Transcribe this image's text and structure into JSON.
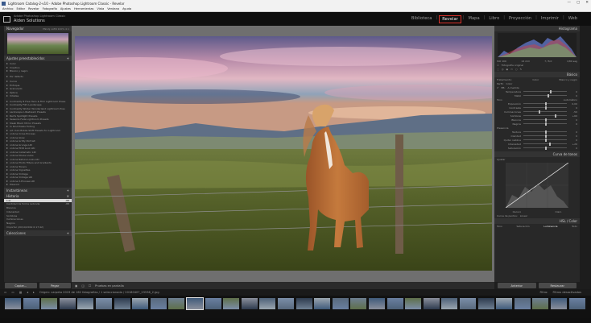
{
  "window": {
    "title": "Lightroom Catalog-2-v10 - Adobe Photoshop Lightroom Classic - Revelar",
    "controls": [
      "—",
      "▢",
      "✕"
    ]
  },
  "menu": [
    "Archivo",
    "Editar",
    "Revelar",
    "Fotografía",
    "Ajustes",
    "Herramientas",
    "Vista",
    "Ventana",
    "Ayuda"
  ],
  "identity": {
    "line1": "Adobe Photoshop Lightroom Classic",
    "line2": "Aiden Solutions"
  },
  "modules": [
    {
      "label": "Biblioteca",
      "active": false
    },
    {
      "label": "Revelar",
      "active": true
    },
    {
      "label": "Mapa",
      "active": false
    },
    {
      "label": "Libro",
      "active": false
    },
    {
      "label": "Proyección",
      "active": false
    },
    {
      "label": "Imprimir",
      "active": false
    },
    {
      "label": "Web",
      "active": false
    }
  ],
  "left_panel": {
    "navigator": {
      "title": "Navegador",
      "zoom_options": "ENCAJ  LLEN  100%  4:1"
    },
    "presets": {
      "title": "Ajustes preestablecidos",
      "items": [
        "Color",
        "Creativo",
        "Blanco y negro",
        "",
        "Por defecto",
        "",
        "Curva",
        "Enfoque",
        "Granulado",
        "Óptica",
        "Viñetas",
        "",
        "Contrastly 8 Free Hero & Film Lightroom Prese",
        "Contrastly Film Landscape",
        "Contrastly Winter Wonderland Lightroom Pres",
        "Landscape Lifestream Presets",
        "Red's Spotlight Presets",
        "Seasons Fade Lightroom Presets",
        "Sleek Black Mirror Presets",
        "In Kind Pixels Tinting",
        "art club Mobile Shift Presets for Lightroom",
        "on1ine Cross Process",
        "on1ine Glow",
        "on1ine Gritty Portrait",
        "on1ine Grunge LRI",
        "on1ine HDR Look LRI",
        "on1ine Instamatic LRI",
        "on1ine Movie Looks",
        "on1ine Nature Looks LRI",
        "on1ine Photo Filters and Gradients",
        "on1ine Toners",
        "on1ine Vignettes",
        "on1ine Vintage",
        "on1ine Vintage LRI",
        "on1ine X-Process LRI",
        "Polaroid"
      ]
    },
    "snapshots_title": "Instantáneas",
    "history": {
      "title": "Historia",
      "rows": [
        {
          "label": "Luz",
          "a": "-88",
          "b": "88",
          "selected": true
        },
        {
          "label": "Cantidad de forma redonda",
          "a": "-88",
          "b": "88",
          "selected": false
        },
        {
          "label": "Blancos",
          "a": "",
          "b": "",
          "selected": false
        },
        {
          "label": "Intensidad",
          "a": "",
          "b": "",
          "selected": false
        },
        {
          "label": "Sombras",
          "a": "",
          "b": "",
          "selected": false
        },
        {
          "label": "Iluminaciones",
          "a": "",
          "b": "",
          "selected": false
        },
        {
          "label": "Negros",
          "a": "",
          "b": "",
          "selected": false
        },
        {
          "label": "Importar (20/10/2019 0:17:42)",
          "a": "",
          "b": "",
          "selected": false
        }
      ]
    },
    "collections_title": "Colecciones",
    "copy_button": "Copiar...",
    "paste_button": "Pegar"
  },
  "toolbar": {
    "preview_label": "Pruebas en pantalla"
  },
  "right_panel": {
    "histogram": {
      "title": "Histograma",
      "readout": [
        "ISO 100",
        "14 mm",
        "f / 8,0",
        "1/80 seg"
      ],
      "original_photo": "Fotografía original"
    },
    "basic": {
      "title": "Básico",
      "treatment_label": "Tratamiento:",
      "treatment_options": [
        "Color",
        "Blanco y negro"
      ],
      "profile_label": "Perfil:",
      "profile_value": "Color",
      "wb_label": "EB:",
      "wb_value": "A medida",
      "tone_label": "Tono",
      "auto_label": "Automático",
      "presence_label": "Presencia",
      "sliders": [
        {
          "label": "Temperatura",
          "value": "0",
          "pos": 0.62
        },
        {
          "label": "Matiz",
          "value": "0",
          "pos": 0.55
        },
        {
          "label": "Exposición",
          "value": "0,00",
          "pos": 0.5
        },
        {
          "label": "Contraste",
          "value": "0",
          "pos": 0.5
        },
        {
          "label": "Iluminaciones",
          "value": "-50",
          "pos": 0.35
        },
        {
          "label": "Sombras",
          "value": "+60",
          "pos": 0.72
        },
        {
          "label": "Blancos",
          "value": "0",
          "pos": 0.5
        },
        {
          "label": "Negros",
          "value": "0",
          "pos": 0.5
        },
        {
          "label": "Textura",
          "value": "0",
          "pos": 0.5
        },
        {
          "label": "Claridad",
          "value": "0",
          "pos": 0.5
        },
        {
          "label": "Quitar neblina",
          "value": "0",
          "pos": 0.5
        },
        {
          "label": "Intensidad",
          "value": "+20",
          "pos": 0.6
        },
        {
          "label": "Saturación",
          "value": "0",
          "pos": 0.5
        }
      ]
    },
    "tone_curve": {
      "title": "Curva de tonos",
      "adjust_label": "Ajustar",
      "region_labels": [
        "Sombras",
        "Oscuro",
        "Claro",
        "Iluminaciones"
      ],
      "channel_label": "Curva de puntos:",
      "channel_value": "Lineal"
    },
    "hsl": {
      "title": "HSL / Color",
      "tabs": [
        "Tono",
        "Saturación",
        "Luminancia",
        "Todo"
      ]
    },
    "prev_button": "Anterior",
    "reset_button": "Restaurar"
  },
  "filmstrip": {
    "info": "Origen: carpeta   2019 de 162 fotografías / 1 seleccionada /  20180407_23536_2.jpg",
    "filter_label": "Filtro:",
    "filter_value": "Filtros desactivados"
  }
}
